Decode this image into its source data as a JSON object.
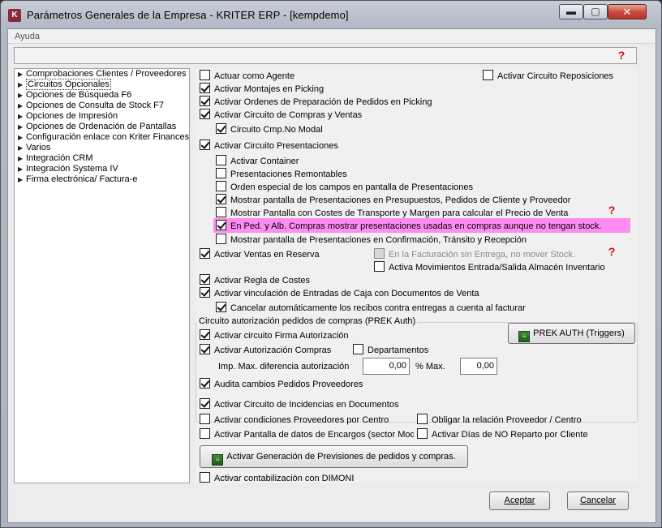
{
  "window": {
    "title": "Parámetros Generales de la Empresa - KRITER ERP - [kempdemo]",
    "min": "▬",
    "max": "▢",
    "close": "✕"
  },
  "menu": {
    "ayuda": "Ayuda"
  },
  "tree": {
    "items": [
      "Comprobaciones Clientes / Proveedores",
      "Circuitos Opcionales",
      "Opciones de Búsqueda F6",
      "Opciones de Consulta de Stock F7",
      "Opciones de Impresión",
      "Opciones de Ordenación de Pantallas",
      "Configuración enlace con Kriter Finances",
      "Varios",
      "Integración CRM",
      "Integración Systema IV",
      "Firma electrónica/ Factura-e"
    ],
    "selected_index": 1
  },
  "options": {
    "actuar_agente": "Actuar como Agente",
    "circuito_reposiciones": "Activar Circuito Reposiciones",
    "montajes_picking": "Activar Montajes en Picking",
    "ordenes_picking": "Activar Ordenes de Preparación de Pedidos en Picking",
    "circuito_compras_ventas": "Activar Circuito de Compras y Ventas",
    "circuito_cmp_no_modal": "Circuito Cmp.No Modal",
    "circuito_presentaciones": "Activar Circuito Presentaciones",
    "activar_container": "Activar Container",
    "presentaciones_remontables": "Presentaciones Remontables",
    "orden_especial": "Orden especial de los campos en pantalla de Presentaciones",
    "mostrar_presupuestos": "Mostrar pantalla de Presentaciones en Presupuestos, Pedidos de Cliente y Proveedor",
    "mostrar_costes": "Mostrar Pantalla con Costes de Transporte y Margen para calcular el Precio de Venta",
    "en_ped_alb": "En Ped. y Alb. Compras mostrar presentaciones usadas en compras aunque no tengan stock.",
    "mostrar_confirmacion": "Mostrar pantalla de Presentaciones en Confirmación, Tránsito y Recepción",
    "ventas_reserva": "Activar Ventas en Reserva",
    "facturacion_sin_entrega": "En la Facturación sin Entrega, no mover Stock.",
    "movimientos_almacen": "Activa Movimientos Entrada/Salida Almacén Inventario",
    "regla_costes": "Activar Regla de Costes",
    "vinculacion_caja": "Activar vinculación de Entradas de Caja con Documentos de Venta",
    "cancelar_recibos": "Cancelar automáticamente los recibos contra entregas a cuenta al facturar"
  },
  "prek": {
    "group_title": "Circuito autorización  pedidos de compras (PREK Auth)",
    "firma_autorizacion": "Activar circuito Firma Autorización",
    "autorizacion_compras": "Activar Autorización Compras",
    "departamentos": "Departamentos",
    "imp_max_label": "Imp. Max. diferencia autorización",
    "imp_max_value": "0,00",
    "pct_max_label": "% Max.",
    "pct_max_value": "0,00",
    "audita": "Audita cambios Pedidos Proveedores",
    "button": "PREK AUTH  (Triggers)"
  },
  "lower": {
    "incidencias": "Activar Circuito de Incidencias en Documentos",
    "condiciones_proveedores": "Activar condiciones Proveedores por Centro",
    "obligar_relacion": "Obligar la relación Proveedor / Centro",
    "pantalla_encargos": "Activar Pantalla de datos de Encargos (sector Moda",
    "dias_no_reparto": "Activar Días de NO Reparto por Cliente",
    "previsiones_button": "Activar Generación de Previsiones de pedidos y compras.",
    "dimoni": "Activar contabilización con DIMONI"
  },
  "footer": {
    "aceptar": "Aceptar",
    "cancelar": "Cancelar"
  },
  "icons": {
    "help": "?",
    "app": "K",
    "button_icon": "≡"
  },
  "colors": {
    "highlight": "#ff8cf0",
    "help": "#cc1010"
  }
}
